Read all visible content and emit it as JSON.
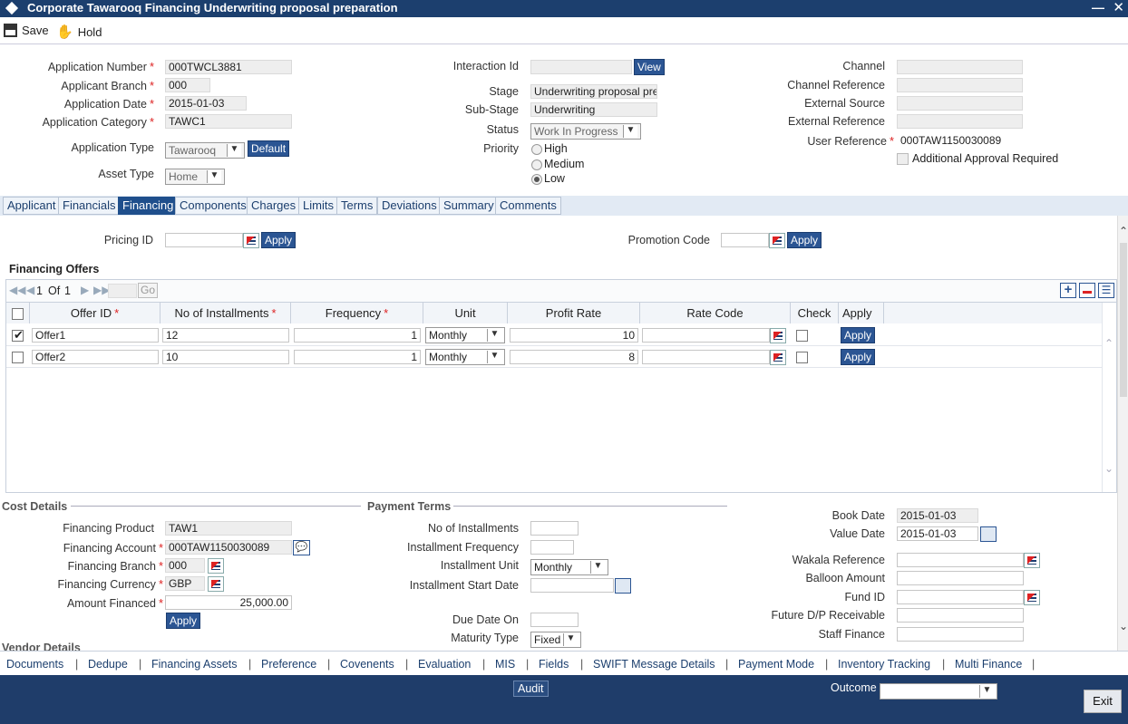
{
  "window": {
    "title": "Corporate Tawarooq Financing Underwriting proposal preparation"
  },
  "toolbar": {
    "save": "Save",
    "hold": "Hold"
  },
  "header": {
    "app_number_label": "Application Number",
    "app_number": "000TWCL3881",
    "applicant_branch_label": "Applicant Branch",
    "applicant_branch": "000",
    "app_date_label": "Application Date",
    "app_date": "2015-01-03",
    "app_category_label": "Application Category",
    "app_category": "TAWC1",
    "app_type_label": "Application Type",
    "app_type": "Tawarooq",
    "default_btn": "Default",
    "asset_type_label": "Asset Type",
    "asset_type": "Home",
    "interaction_id_label": "Interaction Id",
    "view_btn": "View",
    "stage_label": "Stage",
    "stage": "Underwriting proposal pre",
    "substage_label": "Sub-Stage",
    "substage": "Underwriting",
    "status_label": "Status",
    "status": "Work In Progress",
    "priority_label": "Priority",
    "priority_high": "High",
    "priority_medium": "Medium",
    "priority_low": "Low",
    "channel_label": "Channel",
    "channel_ref_label": "Channel Reference",
    "ext_source_label": "External Source",
    "ext_ref_label": "External Reference",
    "user_ref_label": "User Reference",
    "user_ref": "000TAW1150030089",
    "additional_approval_label": "Additional Approval Required"
  },
  "tabs": [
    "Applicant",
    "Financials",
    "Financing",
    "Components",
    "Charges",
    "Limits",
    "Terms",
    "Deviations",
    "Summary",
    "Comments"
  ],
  "pricing": {
    "pricing_id_label": "Pricing ID",
    "apply": "Apply",
    "promotion_code_label": "Promotion Code"
  },
  "offers": {
    "title": "Financing Offers",
    "pager": {
      "page": "1",
      "of": "Of",
      "total": "1",
      "go": "Go"
    },
    "columns": [
      "Offer ID",
      "No of Installments",
      "Frequency",
      "Unit",
      "Profit Rate",
      "Rate Code",
      "Check",
      "Apply"
    ],
    "rows": [
      {
        "offer_id": "Offer1",
        "installments": "12",
        "frequency": "1",
        "unit": "Monthly",
        "profit_rate": "10",
        "apply": "Apply"
      },
      {
        "offer_id": "Offer2",
        "installments": "10",
        "frequency": "1",
        "unit": "Monthly",
        "profit_rate": "8",
        "apply": "Apply"
      }
    ]
  },
  "cost": {
    "title": "Cost Details",
    "product_label": "Financing Product",
    "product": "TAW1",
    "account_label": "Financing Account",
    "account": "000TAW1150030089",
    "branch_label": "Financing Branch",
    "branch": "000",
    "currency_label": "Financing Currency",
    "currency": "GBP",
    "amount_label": "Amount Financed",
    "amount": "25,000.00",
    "apply": "Apply",
    "vendor_title": "Vendor Details"
  },
  "payment": {
    "title": "Payment Terms",
    "installments_label": "No of Installments",
    "freq_label": "Installment Frequency",
    "unit_label": "Installment Unit",
    "unit": "Monthly",
    "start_label": "Installment Start Date",
    "due_label": "Due Date On",
    "maturity_label": "Maturity Type",
    "maturity": "Fixed"
  },
  "right": {
    "book_date_label": "Book Date",
    "book_date": "2015-01-03",
    "value_date_label": "Value Date",
    "value_date": "2015-01-03",
    "wakala_label": "Wakala Reference",
    "balloon_label": "Balloon Amount",
    "fund_label": "Fund ID",
    "future_label": "Future D/P Receivable",
    "staff_label": "Staff Finance"
  },
  "bottom_links": [
    "Documents",
    "Dedupe",
    "Financing Assets",
    "Preference",
    "Covenents",
    "Evaluation",
    "MIS",
    "Fields",
    "SWIFT Message Details",
    "Payment Mode",
    "Inventory Tracking",
    "Multi Finance"
  ],
  "footer": {
    "audit": "Audit",
    "outcome_label": "Outcome",
    "exit": "Exit"
  }
}
